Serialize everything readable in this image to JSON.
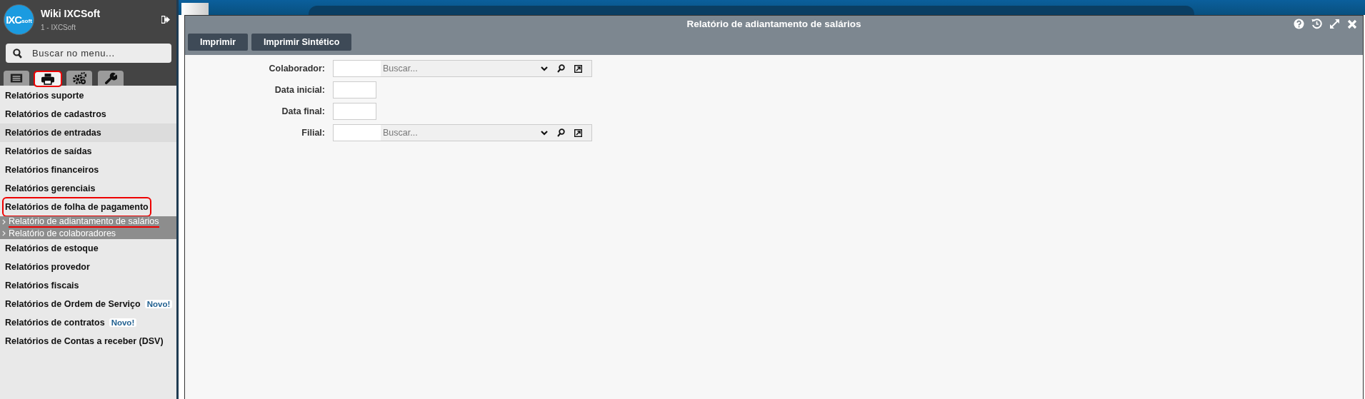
{
  "sidebar": {
    "logo": {
      "main": "IXC",
      "suffix": "soft"
    },
    "title": "Wiki IXCSoft",
    "subtitle": "1 - IXCSoft",
    "search": {
      "placeholder": "Buscar no menu..."
    },
    "tabs": [
      {
        "kind": "list",
        "selected": false,
        "annotated": false
      },
      {
        "kind": "print",
        "selected": true,
        "annotated": true
      },
      {
        "kind": "gears",
        "selected": false,
        "annotated": false
      },
      {
        "kind": "wrench",
        "selected": false,
        "annotated": false
      }
    ],
    "menu": [
      {
        "label": "Relatórios suporte",
        "highlighted": false,
        "annotated": false
      },
      {
        "label": "Relatórios de cadastros",
        "highlighted": false,
        "annotated": false
      },
      {
        "label": "Relatórios de entradas",
        "highlighted": true,
        "annotated": false
      },
      {
        "label": "Relatórios de saídas",
        "highlighted": false,
        "annotated": false
      },
      {
        "label": "Relatórios financeiros",
        "highlighted": false,
        "annotated": false
      },
      {
        "label": "Relatórios gerenciais",
        "highlighted": false,
        "annotated": false
      },
      {
        "label": "Relatórios de folha de pagamento",
        "highlighted": false,
        "annotated": true,
        "children": [
          {
            "label": "Relatório de adiantamento de salários",
            "annotated": true
          },
          {
            "label": "Relatório de colaboradores",
            "annotated": false
          }
        ]
      },
      {
        "label": "Relatórios de estoque",
        "highlighted": false,
        "annotated": false
      },
      {
        "label": "Relatórios provedor",
        "highlighted": false,
        "annotated": false
      },
      {
        "label": "Relatórios fiscais",
        "highlighted": false,
        "annotated": false
      },
      {
        "label": "Relatórios de Ordem de Serviço",
        "highlighted": false,
        "annotated": false,
        "badge": "Novo!"
      },
      {
        "label": "Relatórios de contratos",
        "highlighted": false,
        "annotated": false,
        "badge": "Novo!"
      },
      {
        "label": "Relatórios de Contas a receber (DSV)",
        "highlighted": false,
        "annotated": false
      }
    ]
  },
  "window": {
    "title": "Relatório de adiantamento de salários",
    "toolbar": [
      "Imprimir",
      "Imprimir Sintético"
    ],
    "form": [
      {
        "kind": "lookup",
        "label": "Colaborador:",
        "placeholder": "Buscar..."
      },
      {
        "kind": "date",
        "label": "Data inicial:"
      },
      {
        "kind": "date",
        "label": "Data final:"
      },
      {
        "kind": "lookup",
        "label": "Filial:",
        "placeholder": "Buscar..."
      }
    ]
  }
}
